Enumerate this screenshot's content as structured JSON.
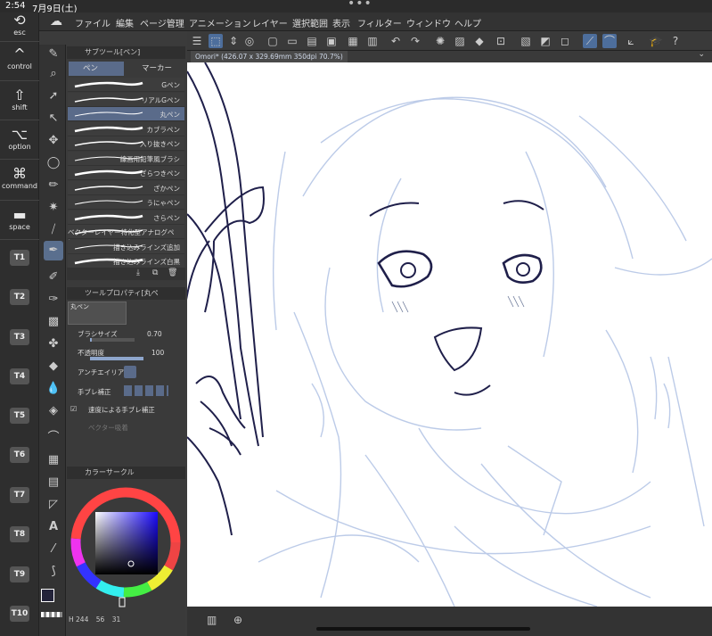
{
  "status": {
    "time": "2:54",
    "date": "7月9日(土)",
    "dots": "•••"
  },
  "keys": [
    {
      "glyph": "⟲",
      "label": "esc"
    },
    {
      "glyph": "^",
      "label": "control"
    },
    {
      "glyph": "⇧",
      "label": "shift"
    },
    {
      "glyph": "⌥",
      "label": "option"
    },
    {
      "glyph": "⌘",
      "label": "command"
    },
    {
      "glyph": "▬",
      "label": "space"
    }
  ],
  "tkeys": [
    "T1",
    "T2",
    "T3",
    "T4",
    "T5",
    "T6",
    "T7",
    "T8",
    "T9",
    "T10"
  ],
  "menu": [
    "ファイル",
    "編集",
    "ページ管理",
    "アニメーション",
    "レイヤー",
    "選択範囲",
    "表示",
    "フィルター",
    "ウィンドウ",
    "ヘルプ"
  ],
  "subtool": {
    "title": "サブツール[ペン]",
    "tab_pen": "ペン",
    "tab_marker": "マーカー",
    "brushes": [
      "Gペン",
      "リアルGペン",
      "丸ペン",
      "カブラペン",
      "入り抜きペン",
      "線画用鉛筆風ブラシ",
      "ざらつきペン",
      "ざかペン",
      "うにゃペン",
      "さらペン",
      "ベクターレイヤー特化型アナログペン",
      "描き込みラインズ追加",
      "描き込みラインズ白黒"
    ],
    "selected_index": 2
  },
  "toolprop": {
    "title": "ツールプロパティ[丸ペ",
    "preset_name": "丸ペン",
    "brush_size_label": "ブラシサイズ",
    "brush_size": "0.70",
    "opacity_label": "不透明度",
    "opacity": "100",
    "antialias_label": "アンチエイリアス",
    "stabilization_label": "手ブレ補正",
    "speed_label": "速度による手ブレ補正",
    "vector_label": "ベクター吸着"
  },
  "color": {
    "title": "カラーサークル",
    "main_hex": "#24243a",
    "sub_hex": "#ffffff",
    "h": "244",
    "s": "56",
    "v": "31",
    "h_label": "H"
  },
  "document": {
    "tab": "Omori* (426.07 x 329.69mm 350dpi 70.7%)"
  }
}
